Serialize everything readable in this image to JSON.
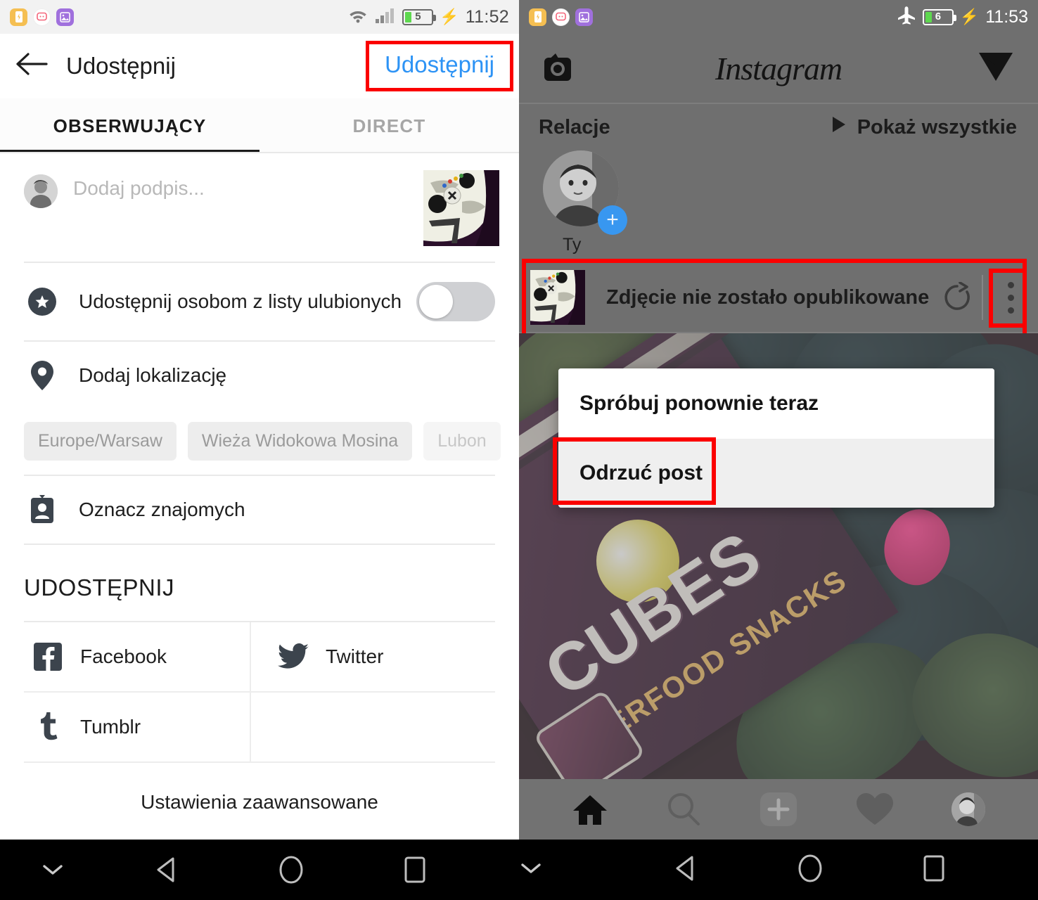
{
  "left": {
    "statusbar": {
      "notification_icons": [
        "battery-saver-icon",
        "message-icon",
        "photo-icon"
      ],
      "wifi_icon": "wifi-icon",
      "signal_icon": "signal-bars-icon",
      "battery_level": "5",
      "charging_icon": "charging-bolt-icon",
      "time": "11:52"
    },
    "header": {
      "back_icon": "back-arrow-icon",
      "title": "Udostępnij",
      "share_action": "Udostępnij"
    },
    "tabs": [
      {
        "label": "OBSERWUJĄCY",
        "active": true
      },
      {
        "label": "DIRECT",
        "active": false
      }
    ],
    "caption": {
      "avatar": "user-avatar",
      "placeholder": "Dodaj podpis...",
      "value": "",
      "thumbnail": "xbox-controller-thumbnail"
    },
    "rows": [
      {
        "icon": "star-circle-icon",
        "label": "Udostępnij osobom z listy ulubionych",
        "toggle": "off"
      },
      {
        "icon": "location-pin-icon",
        "label": "Dodaj lokalizację"
      },
      {
        "icon": "tag-person-icon",
        "label": "Oznacz znajomych"
      }
    ],
    "location_chips": [
      "Europe/Warsaw",
      "Wieża Widokowa Mosina",
      "Lubon"
    ],
    "share_section": {
      "title": "UDOSTĘPNIJ",
      "items": [
        {
          "icon": "facebook-icon",
          "label": "Facebook"
        },
        {
          "icon": "twitter-icon",
          "label": "Twitter"
        },
        {
          "icon": "tumblr-icon",
          "label": "Tumblr"
        }
      ]
    },
    "advanced_settings": "Ustawienia zaawansowane",
    "navbar": [
      "chevron-down-icon",
      "back-triangle-icon",
      "home-circle-icon",
      "recents-square-icon"
    ]
  },
  "right": {
    "statusbar": {
      "notification_icons": [
        "battery-saver-icon",
        "message-icon",
        "photo-icon"
      ],
      "airplane_icon": "airplane-mode-icon",
      "battery_level": "6",
      "charging_icon": "charging-bolt-icon",
      "time": "11:53"
    },
    "header": {
      "camera_icon": "camera-icon",
      "logo": "Instagram",
      "direct_icon": "send-paperplane-icon"
    },
    "stories": {
      "label": "Relacje",
      "show_all": "Pokaż wszystkie",
      "play_icon": "play-triangle-icon",
      "items": [
        {
          "name": "Ty",
          "avatar": "user-avatar",
          "badge": "plus-icon"
        }
      ]
    },
    "error_bar": {
      "thumbnail": "xbox-controller-thumbnail",
      "message": "Zdjęcie nie zostało opublikowane",
      "retry_icon": "retry-refresh-icon",
      "menu_icon": "kebab-menu-icon"
    },
    "popup_menu": [
      {
        "label": "Spróbuj ponownie teraz",
        "highlighted": false
      },
      {
        "label": "Odrzuć post",
        "highlighted": true
      }
    ],
    "feed_photo": {
      "brand": "CUBES",
      "tagline": "SUPERFOOD SNACKS"
    },
    "tabbar": [
      "home-icon",
      "search-icon",
      "add-post-icon",
      "heart-activity-icon",
      "profile-avatar-icon"
    ],
    "navbar": [
      "chevron-down-icon",
      "back-triangle-icon",
      "home-circle-icon",
      "recents-square-icon"
    ]
  },
  "annotations": {
    "highlight_color": "#fb0000",
    "boxes": [
      "share-button-highlight",
      "error-bar-highlight",
      "kebab-menu-highlight",
      "odrzuc-post-highlight"
    ]
  }
}
